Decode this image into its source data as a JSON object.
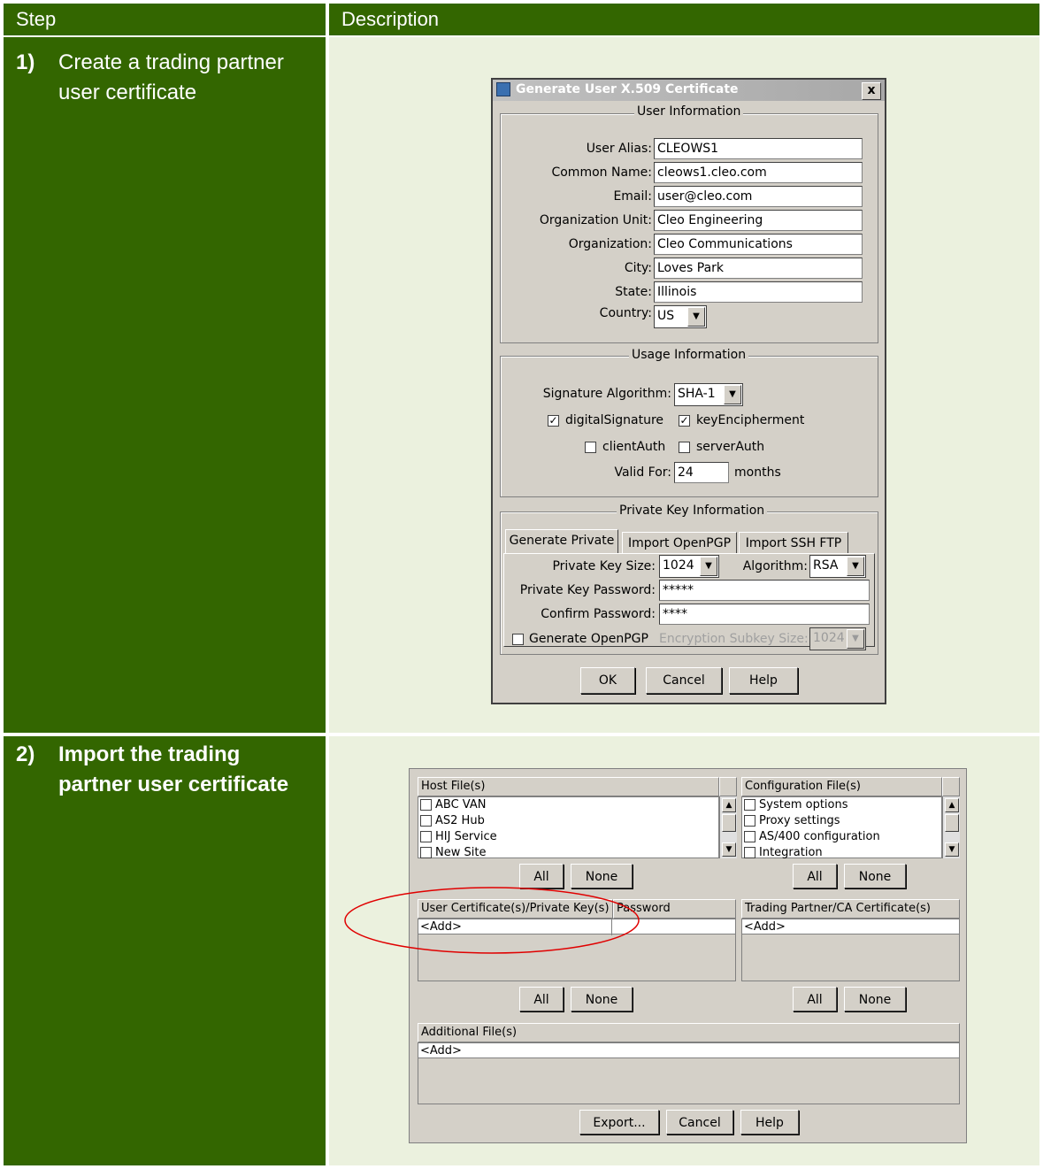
{
  "table": {
    "header": {
      "step": "Step",
      "description": "Description"
    },
    "rows": [
      {
        "number": "1)",
        "text": "Create a trading partner user certificate"
      },
      {
        "number": "2)",
        "text": "Import the trading partner user certificate"
      }
    ]
  },
  "dialog1": {
    "title": "Generate User X.509 Certificate",
    "close": "x",
    "user_info": {
      "legend": "User Information",
      "fields": [
        {
          "label": "User Alias:",
          "value": "CLEOWS1"
        },
        {
          "label": "Common Name:",
          "value": "cleows1.cleo.com"
        },
        {
          "label": "Email:",
          "value": "user@cleo.com"
        },
        {
          "label": "Organization Unit:",
          "value": "Cleo Engineering"
        },
        {
          "label": "Organization:",
          "value": "Cleo Communications"
        },
        {
          "label": "City:",
          "value": "Loves Park"
        },
        {
          "label": "State:",
          "value": "Illinois"
        }
      ],
      "country_label": "Country:",
      "country_value": "US"
    },
    "usage_info": {
      "legend": "Usage Information",
      "sig_label": "Signature Algorithm:",
      "sig_value": "SHA-1",
      "checks": [
        {
          "label": "digitalSignature",
          "checked": true
        },
        {
          "label": "keyEncipherment",
          "checked": true
        },
        {
          "label": "clientAuth",
          "checked": false
        },
        {
          "label": "serverAuth",
          "checked": false
        }
      ],
      "valid_label": "Valid For:",
      "valid_value": "24",
      "valid_unit": "months"
    },
    "private_key": {
      "legend": "Private Key Information",
      "tabs": [
        "Generate Private",
        "Import OpenPGP",
        "Import SSH FTP"
      ],
      "size_label": "Private Key Size:",
      "size_value": "1024",
      "algo_label": "Algorithm:",
      "algo_value": "RSA",
      "pw_label": "Private Key Password:",
      "pw_value": "*****",
      "confirm_label": "Confirm Password:",
      "confirm_value": "****",
      "openpgp_label": "Generate OpenPGP",
      "subkey_label": "Encryption Subkey Size:",
      "subkey_value": "1024"
    },
    "buttons": {
      "ok": "OK",
      "cancel": "Cancel",
      "help": "Help"
    }
  },
  "dialog2": {
    "host_header": "Host File(s)",
    "host_items": [
      "ABC VAN",
      "AS2 Hub",
      "HIJ Service",
      "New Site"
    ],
    "config_header": "Configuration File(s)",
    "config_items": [
      "System options",
      "Proxy settings",
      "AS/400 configuration",
      "Integration"
    ],
    "all": "All",
    "none": "None",
    "usercert_header": "User Certificate(s)/Private Key(s)",
    "password_header": "Password",
    "add": "<Add>",
    "tp_header": "Trading Partner/CA Certificate(s)",
    "additional_header": "Additional File(s)",
    "buttons": {
      "export": "Export...",
      "cancel": "Cancel",
      "help": "Help"
    },
    "highlight_color": "#e00000"
  }
}
